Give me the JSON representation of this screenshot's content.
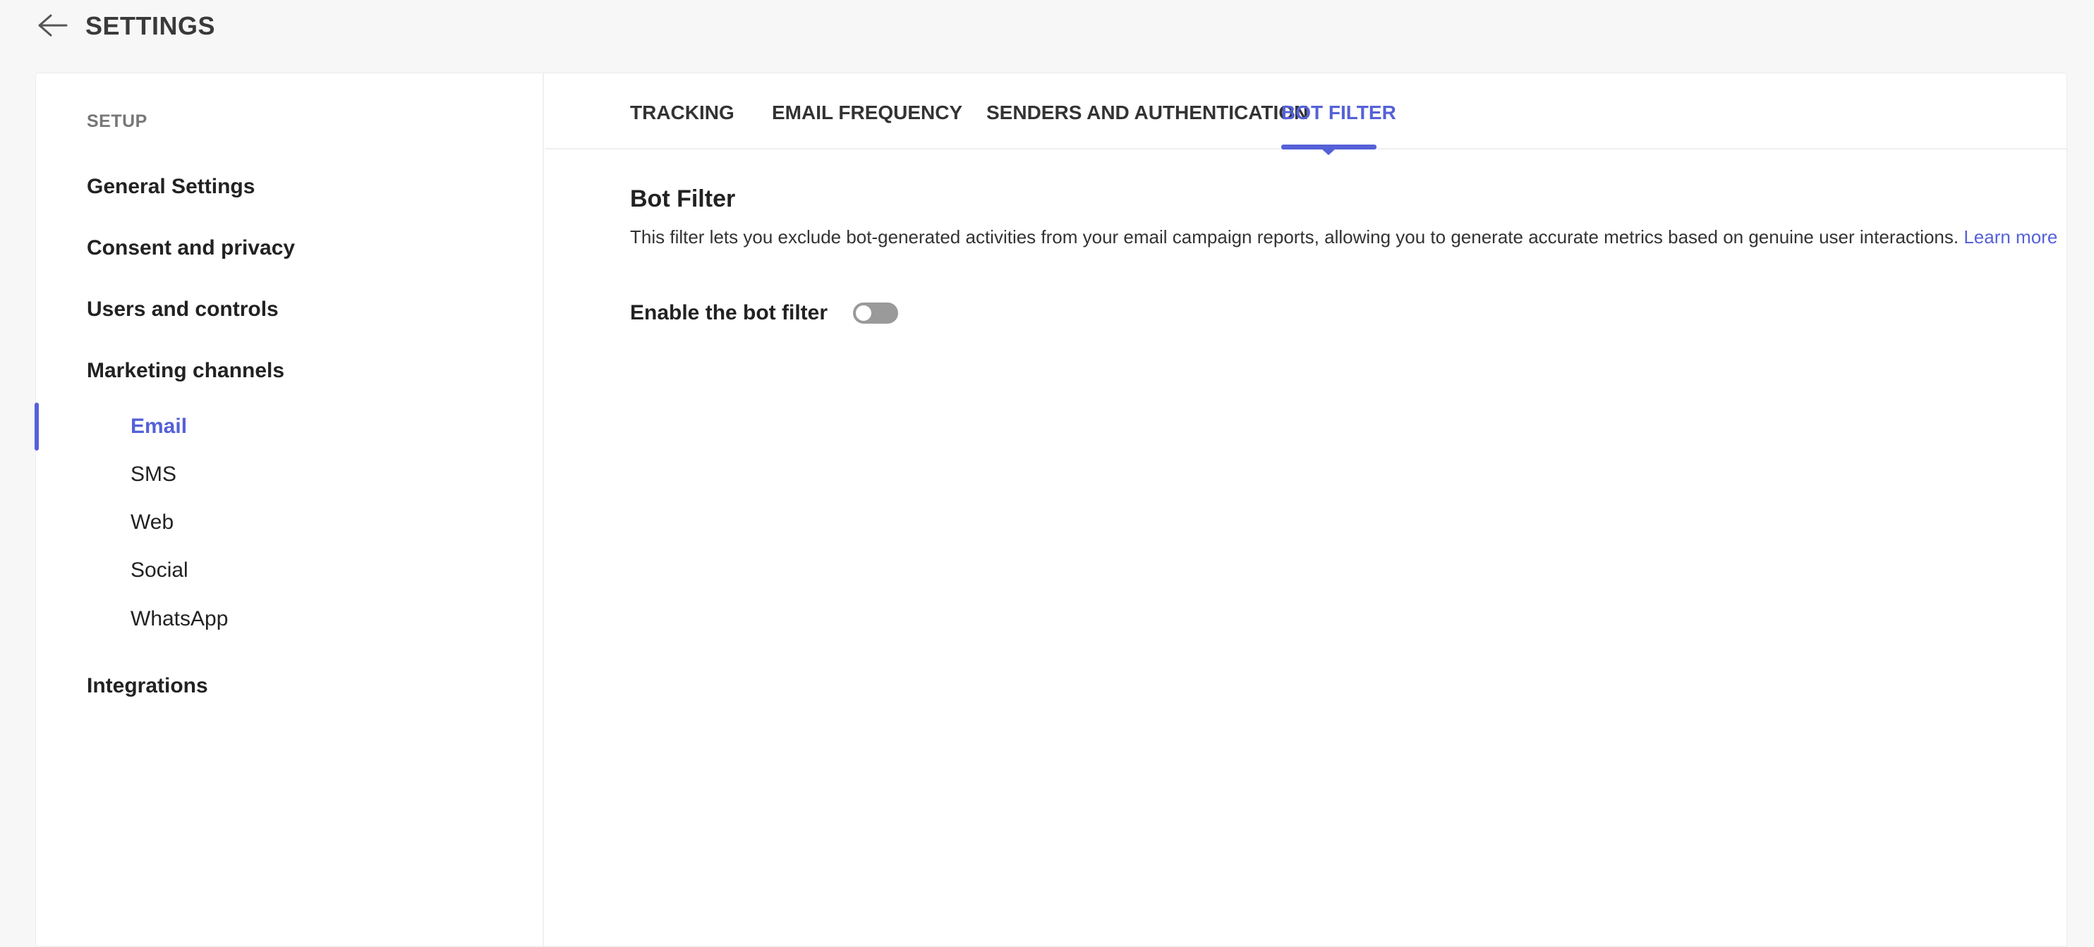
{
  "header": {
    "back_icon": "arrow-left-icon",
    "title": "SETTINGS"
  },
  "sidebar": {
    "heading": "SETUP",
    "items": [
      {
        "label": "General Settings"
      },
      {
        "label": "Consent and privacy"
      },
      {
        "label": "Users and controls"
      },
      {
        "label": "Marketing channels"
      },
      {
        "label": "Integrations"
      }
    ],
    "sub_items": [
      {
        "label": "Email",
        "active": true
      },
      {
        "label": "SMS"
      },
      {
        "label": "Web"
      },
      {
        "label": "Social"
      },
      {
        "label": "WhatsApp"
      }
    ]
  },
  "tabs": [
    {
      "label": "TRACKING"
    },
    {
      "label": "EMAIL FREQUENCY"
    },
    {
      "label": "SENDERS AND AUTHENTICATION"
    },
    {
      "label": "BOT FILTER",
      "active": true
    }
  ],
  "section": {
    "title": "Bot Filter",
    "description": "This filter lets you exclude bot-generated activities from your email campaign reports, allowing you to generate accurate metrics based on genuine user interactions.",
    "learn_more": "Learn more"
  },
  "bot_filter": {
    "label": "Enable the bot filter",
    "enabled": false
  },
  "colors": {
    "accent": "#5561d8",
    "toggle_off": "#9a9a9a"
  }
}
